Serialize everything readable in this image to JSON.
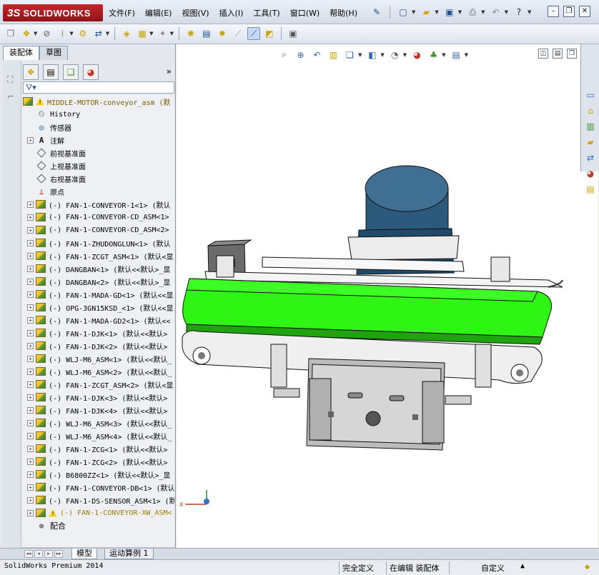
{
  "app": {
    "logo_prefix": "3S",
    "logo_name": "SOLIDWORKS",
    "menus": [
      "文件(F)",
      "编辑(E)",
      "视图(V)",
      "插入(I)",
      "工具(T)",
      "窗口(W)",
      "帮助(H)"
    ]
  },
  "left_panel": {
    "tabs": [
      "装配体",
      "草图"
    ],
    "tree": {
      "root": "MIDDLE-MOTOR-conveyor_asm  (默",
      "features": [
        {
          "label": "History",
          "icon": "history-icon"
        },
        {
          "label": "传感器",
          "icon": "sensor-icon"
        },
        {
          "label": "注解",
          "icon": "annotation-icon"
        },
        {
          "label": "前视基准面",
          "icon": "plane-icon"
        },
        {
          "label": "上视基准面",
          "icon": "plane-icon"
        },
        {
          "label": "右视基准面",
          "icon": "plane-icon"
        },
        {
          "label": "原点",
          "icon": "origin-icon"
        }
      ],
      "components": [
        "(-) FAN-1-CONVEYOR-1<1> (默认",
        "(-) FAN-1-CONVEYOR-CD_ASM<1>",
        "(-) FAN-1-CONVEYOR-CD_ASM<2>",
        "(-) FAN-1-ZHUDONGLUN<1> (默认",
        "(-) FAN-1-ZCGT_ASM<1> (默认<显",
        "(-) DANGBAN<1> (默认<<默认>_显",
        "(-) DANGBAN<2> (默认<<默认>_显",
        "(-) FAN-1-MADA-GD<1> (默认<<显",
        "(-) OPG-3GN15KSD_<1> (默认<<显",
        "(-) FAN-1-MADA-GD2<1> (默认<<",
        "(-) FAN-1-DJK<1> (默认<<默认>",
        "(-) FAN-1-DJK<2> (默认<<默认>",
        "(-) WLJ-M6_ASM<1> (默认<<默认_",
        "(-) WLJ-M6_ASM<2> (默认<<默认_",
        "(-) FAN-1-ZCGT_ASM<2> (默认<显",
        "(-) FAN-1-DJK<3> (默认<<默认>",
        "(-) FAN-1-DJK<4> (默认<<默认>",
        "(-) WLJ-M6_ASM<3> (默认<<默认_",
        "(-) WLJ-M6_ASM<4> (默认<<默认_",
        "(-) FAN-1-ZCG<1> (默认<<默认>",
        "(-) FAN-1-ZCG<2> (默认<<默认>",
        "(-) B6800ZZ<1> (默认<<默认>_显",
        "(-) FAN-1-CONVEYOR-DB<1> (默认",
        "(-) FAN-1-DS-SENSOR_ASM<1> (默认"
      ],
      "last_component": "(-) FAN-1-CONVEYOR-XW_ASM<",
      "mates": "配合"
    }
  },
  "bottom_tabs": [
    "模型",
    "运动算例 1"
  ],
  "status": {
    "product": "SolidWorks Premium 2014",
    "definition": "完全定义",
    "editing": "在编辑 装配体",
    "units": "自定义",
    "units_arrow": "▲"
  },
  "colors": {
    "belt_green": "#2ef514",
    "motor_blue": "#2b5a7c",
    "logo_red": "#c8242b"
  }
}
